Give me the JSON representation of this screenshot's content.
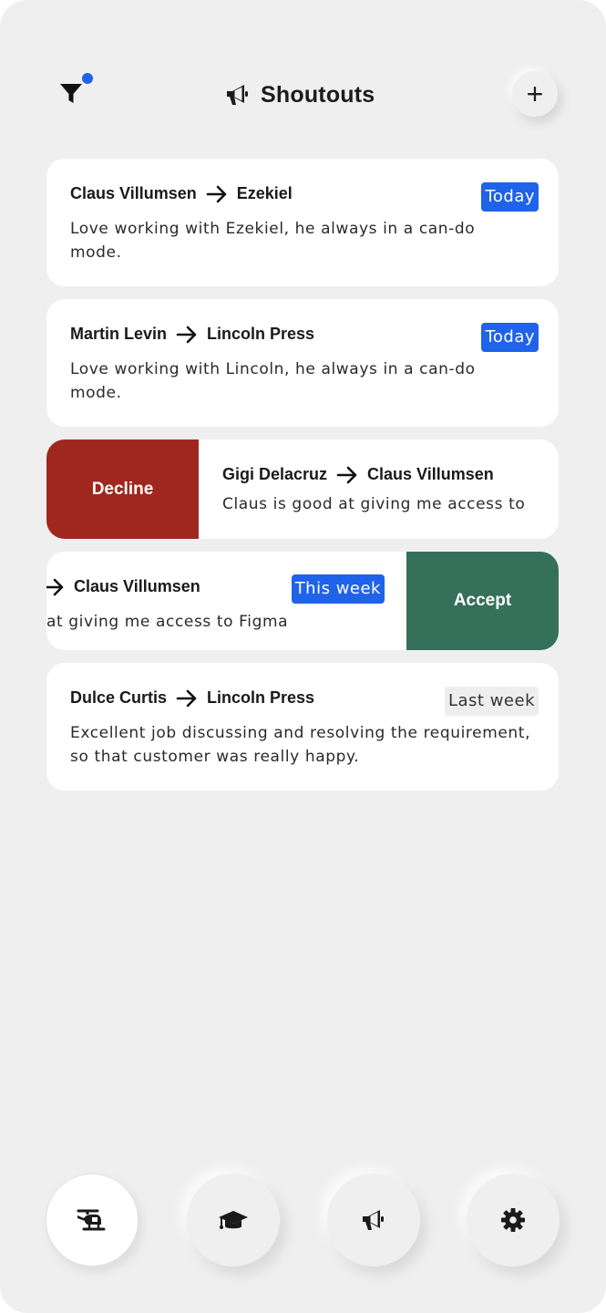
{
  "header": {
    "title": "Shoutouts",
    "filter_icon": "filter-icon",
    "title_icon": "megaphone-icon",
    "add_label": "+"
  },
  "colors": {
    "accent": "#1e63e9",
    "decline": "#a0271d",
    "accept": "#35705a",
    "background": "#efefef"
  },
  "shoutouts": [
    {
      "from": "Claus Villumsen",
      "to": "Ezekiel",
      "badge": "Today",
      "message": "Love working with Ezekiel, he always in a can-do mode."
    },
    {
      "from": "Martin Levin",
      "to": "Lincoln Press",
      "badge": "Today",
      "message": "Love working with Lincoln, he always in a can-do mode."
    },
    {
      "from": "Gigi Delacruz",
      "to": "Claus Villumsen",
      "message": "Claus is good at giving me access to",
      "action": "Decline"
    },
    {
      "to": "Claus Villumsen",
      "badge": "This week",
      "message": "at giving me access to Figma",
      "action": "Accept"
    },
    {
      "from": "Dulce Curtis",
      "to": "Lincoln Press",
      "badge": "Last week",
      "message": "Excellent job discussing and resolving the requirement, so that customer was really happy."
    }
  ],
  "nav": [
    {
      "icon": "helicopter-icon",
      "active": true
    },
    {
      "icon": "graduation-cap-icon",
      "active": false
    },
    {
      "icon": "megaphone-icon",
      "active": false
    },
    {
      "icon": "gear-icon",
      "active": false
    }
  ]
}
